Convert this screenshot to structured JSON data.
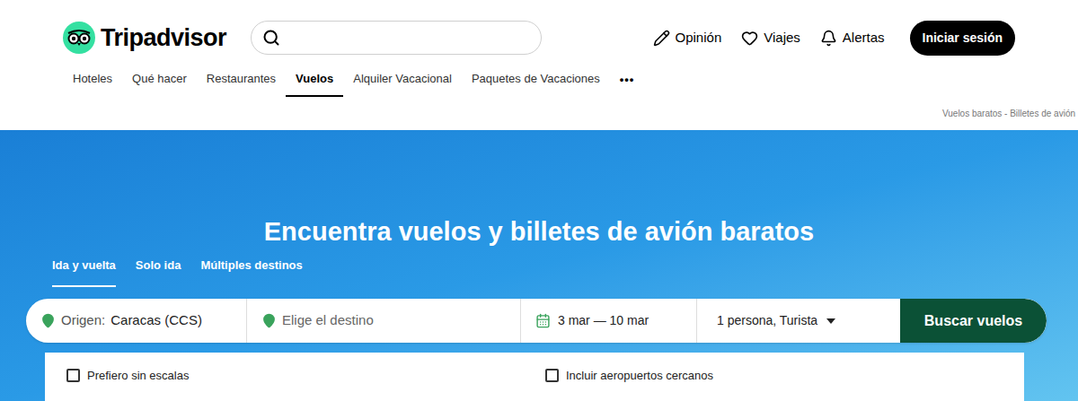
{
  "header": {
    "logo": "Tripadvisor",
    "actions": [
      {
        "label": "Opinión"
      },
      {
        "label": "Viajes"
      },
      {
        "label": "Alertas"
      }
    ],
    "login": "Iniciar sesión"
  },
  "nav": [
    {
      "label": "Hoteles",
      "selected": false
    },
    {
      "label": "Qué hacer",
      "selected": false
    },
    {
      "label": "Restaurantes",
      "selected": false
    },
    {
      "label": "Vuelos",
      "selected": true
    },
    {
      "label": "Alquiler Vacacional",
      "selected": false
    },
    {
      "label": "Paquetes de Vacaciones",
      "selected": false
    }
  ],
  "nav_more": "•••",
  "breadcrumb": "Vuelos baratos - Billetes de avión",
  "hero": {
    "title": "Encuentra vuelos y billetes de avión baratos",
    "trip_types": [
      {
        "label": "Ida y vuelta",
        "selected": true
      },
      {
        "label": "Solo ida",
        "selected": false
      },
      {
        "label": "Múltiples destinos",
        "selected": false
      }
    ],
    "search": {
      "origin_label": "Origen:",
      "origin": "Caracas (CCS)",
      "destination_placeholder": "Elige el destino",
      "dates": "3 mar — 10 mar",
      "travellers": "1 persona, Turista",
      "button": "Buscar vuelos"
    },
    "options": [
      {
        "label": "Prefiero sin escalas",
        "checked": false
      },
      {
        "label": "Incluir aeropuertos cercanos",
        "checked": false
      }
    ]
  }
}
